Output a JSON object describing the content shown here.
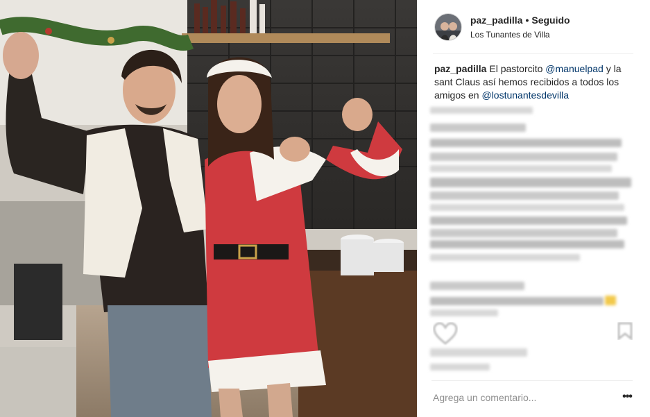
{
  "post": {
    "username": "paz_padilla",
    "separator": "•",
    "follow_state": "Seguido",
    "location": "Los Tunantes de Villa",
    "caption": {
      "user": "paz_padilla",
      "text_1": "El pastorcito",
      "mention_1": "@manuelpad",
      "text_2": "y la sant Claus así hemos recibidos a todos los amigos en",
      "mention_2": "@lostunantesdevilla"
    },
    "comment_placeholder": "Agrega un comentario...",
    "more_options": "•••"
  },
  "icons": {
    "avatar": "profile-avatar",
    "like": "heart-icon",
    "save": "bookmark-icon"
  },
  "colors": {
    "text": "#262626",
    "link": "#003569",
    "muted": "#8e8e8e",
    "divider": "#efefef"
  }
}
